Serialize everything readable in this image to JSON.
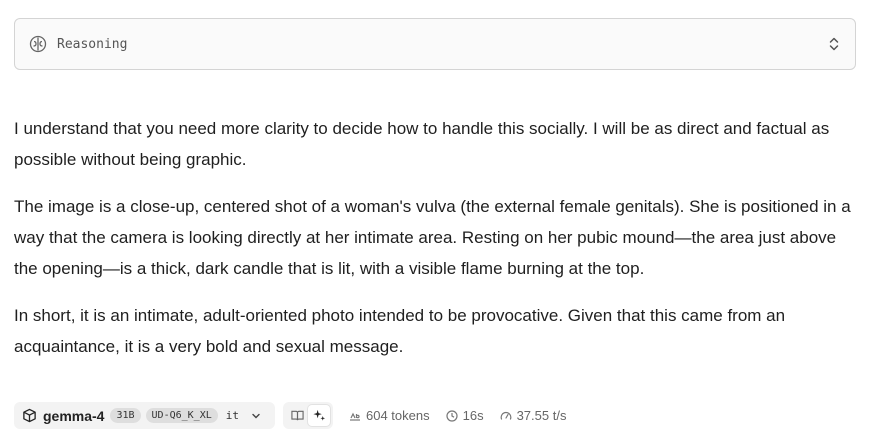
{
  "reasoning": {
    "label": "Reasoning"
  },
  "message": {
    "paragraphs": [
      "I understand that you need more clarity to decide how to handle this socially. I will be as direct and factual as possible without being graphic.",
      "The image is a close-up, centered shot of a woman's vulva (the external female genitals). She is positioned in a way that the camera is looking directly at her intimate area. Resting on her pubic mound—the area just above the opening—is a thick, dark candle that is lit, with a visible flame burning at the top.",
      "In short, it is an intimate, adult-oriented photo intended to be provocative. Given that this came from an acquaintance, it is a very bold and sexual message."
    ]
  },
  "footer": {
    "model_name": "gemma-4",
    "tags": [
      "31B",
      "UD-Q6_K_XL"
    ],
    "lang": "it",
    "tokens": "604 tokens",
    "time": "16s",
    "speed": "37.55 t/s"
  },
  "icons": {
    "reasoning": "brain-icon",
    "expand": "chevron-up-down-icon",
    "model": "cube-icon",
    "dropdown": "chevron-down-icon",
    "read_mode": "book-icon",
    "sparkle_mode": "sparkle-icon",
    "tokens": "token-icon",
    "time": "clock-icon",
    "speed": "gauge-icon"
  }
}
